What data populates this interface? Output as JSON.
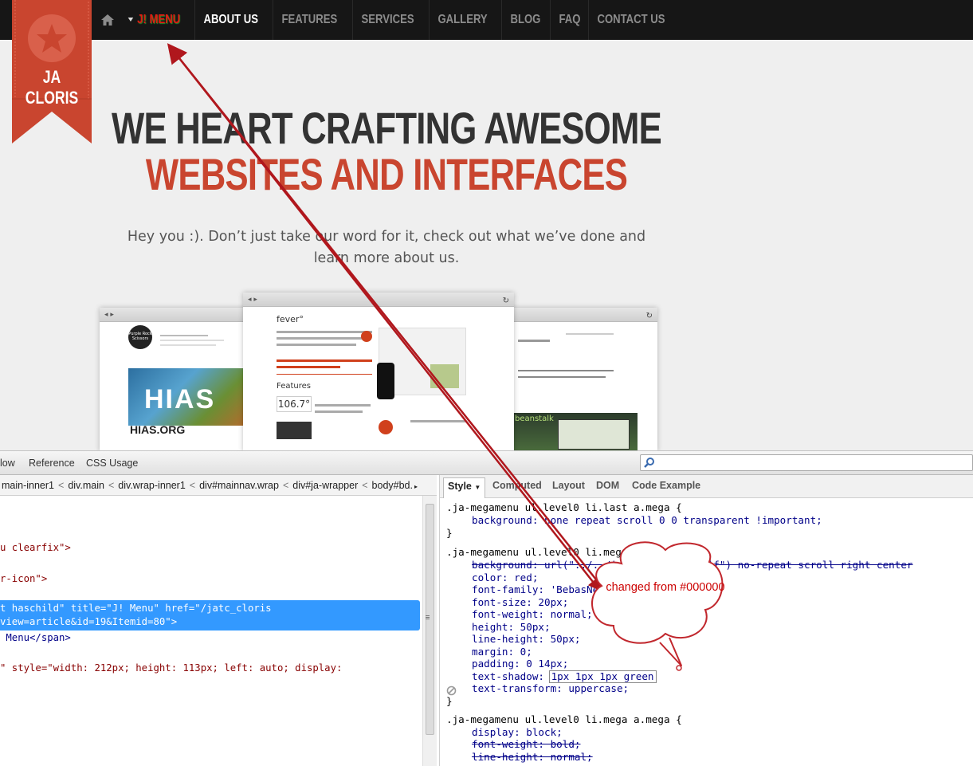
{
  "site": {
    "nav": {
      "jmenu": "J! MENU",
      "items": [
        "ABOUT US",
        "FEATURES",
        "SERVICES",
        "GALLERY",
        "BLOG",
        "FAQ",
        "CONTACT US"
      ]
    },
    "logo": "JA CLORIS",
    "hero_line1": "WE HEART CRAFTING AWESOME",
    "hero_line2": "WEBSITES AND INTERFACES",
    "tagline": "Hey you :). Don’t just take our word for it, check out what we’ve done and learn more about us.",
    "mockups": {
      "left_logo": "Purple Rock Scissors",
      "left_hero": "HIAS",
      "left_site": "HIAS.ORG",
      "center_brand": "fever°",
      "center_features": "Features",
      "center_temp": "106.7°",
      "right_brand": "beanstalk"
    },
    "colors": {
      "accent": "#c9452f",
      "menu_red": "#e01b12",
      "selection": "#3399ff"
    }
  },
  "devtools": {
    "toolbar_tabs": [
      "low",
      "Reference",
      "CSS Usage"
    ],
    "breadcrumbs": [
      "main-inner1",
      "div.main",
      "div.wrap-inner1",
      "div#mainnav.wrap",
      "div#ja-wrapper",
      "body#bd."
    ],
    "html_lines": [
      {
        "text": "u clearfix\">"
      },
      {
        "text": "r-icon\">"
      },
      {
        "text": "t haschild\" title=\"J! Menu\" href=\"/jatc_cloris"
      },
      {
        "text": "view=article&id=19&Itemid=80\">"
      },
      {
        "text": " Menu</span>"
      },
      {
        "text": "\" style=\"width: 212px; height: 113px; left: auto; display:"
      }
    ],
    "style_tabs": [
      "Style",
      "Computed",
      "Layout",
      "DOM",
      "Code Example"
    ],
    "css": {
      "rule1_selector": ".ja-megamenu ul.level0 li.last a.mega {",
      "rule1_decl": "background: none repeat scroll 0 0 transparent !important;",
      "rule2_selector": ".ja-megamenu ul.level0 li.mega a.mega {",
      "rule2_bg": "background: url(\"../../images/nav-sep.gif\") no-repeat scroll right center",
      "rule2_lines": [
        "color: red;",
        "font-family: 'BebasNeueRegular';",
        "font-size: 20px;",
        "font-weight: normal;",
        "height: 50px;",
        "line-height: 50px;",
        "margin: 0;",
        "padding: 0 14px;"
      ],
      "text_shadow_prop": "text-shadow:",
      "text_shadow_value": "1px 1px 1px green",
      "text_transform": "text-transform: uppercase;",
      "close": "}",
      "rule3_selector": ".ja-megamenu ul.level0 li.mega a.mega {",
      "rule3_lines": [
        "display: block;",
        "font-weight: bold;",
        "line-height: normal;"
      ]
    }
  },
  "annotation": {
    "callout": "changed from #000000"
  }
}
